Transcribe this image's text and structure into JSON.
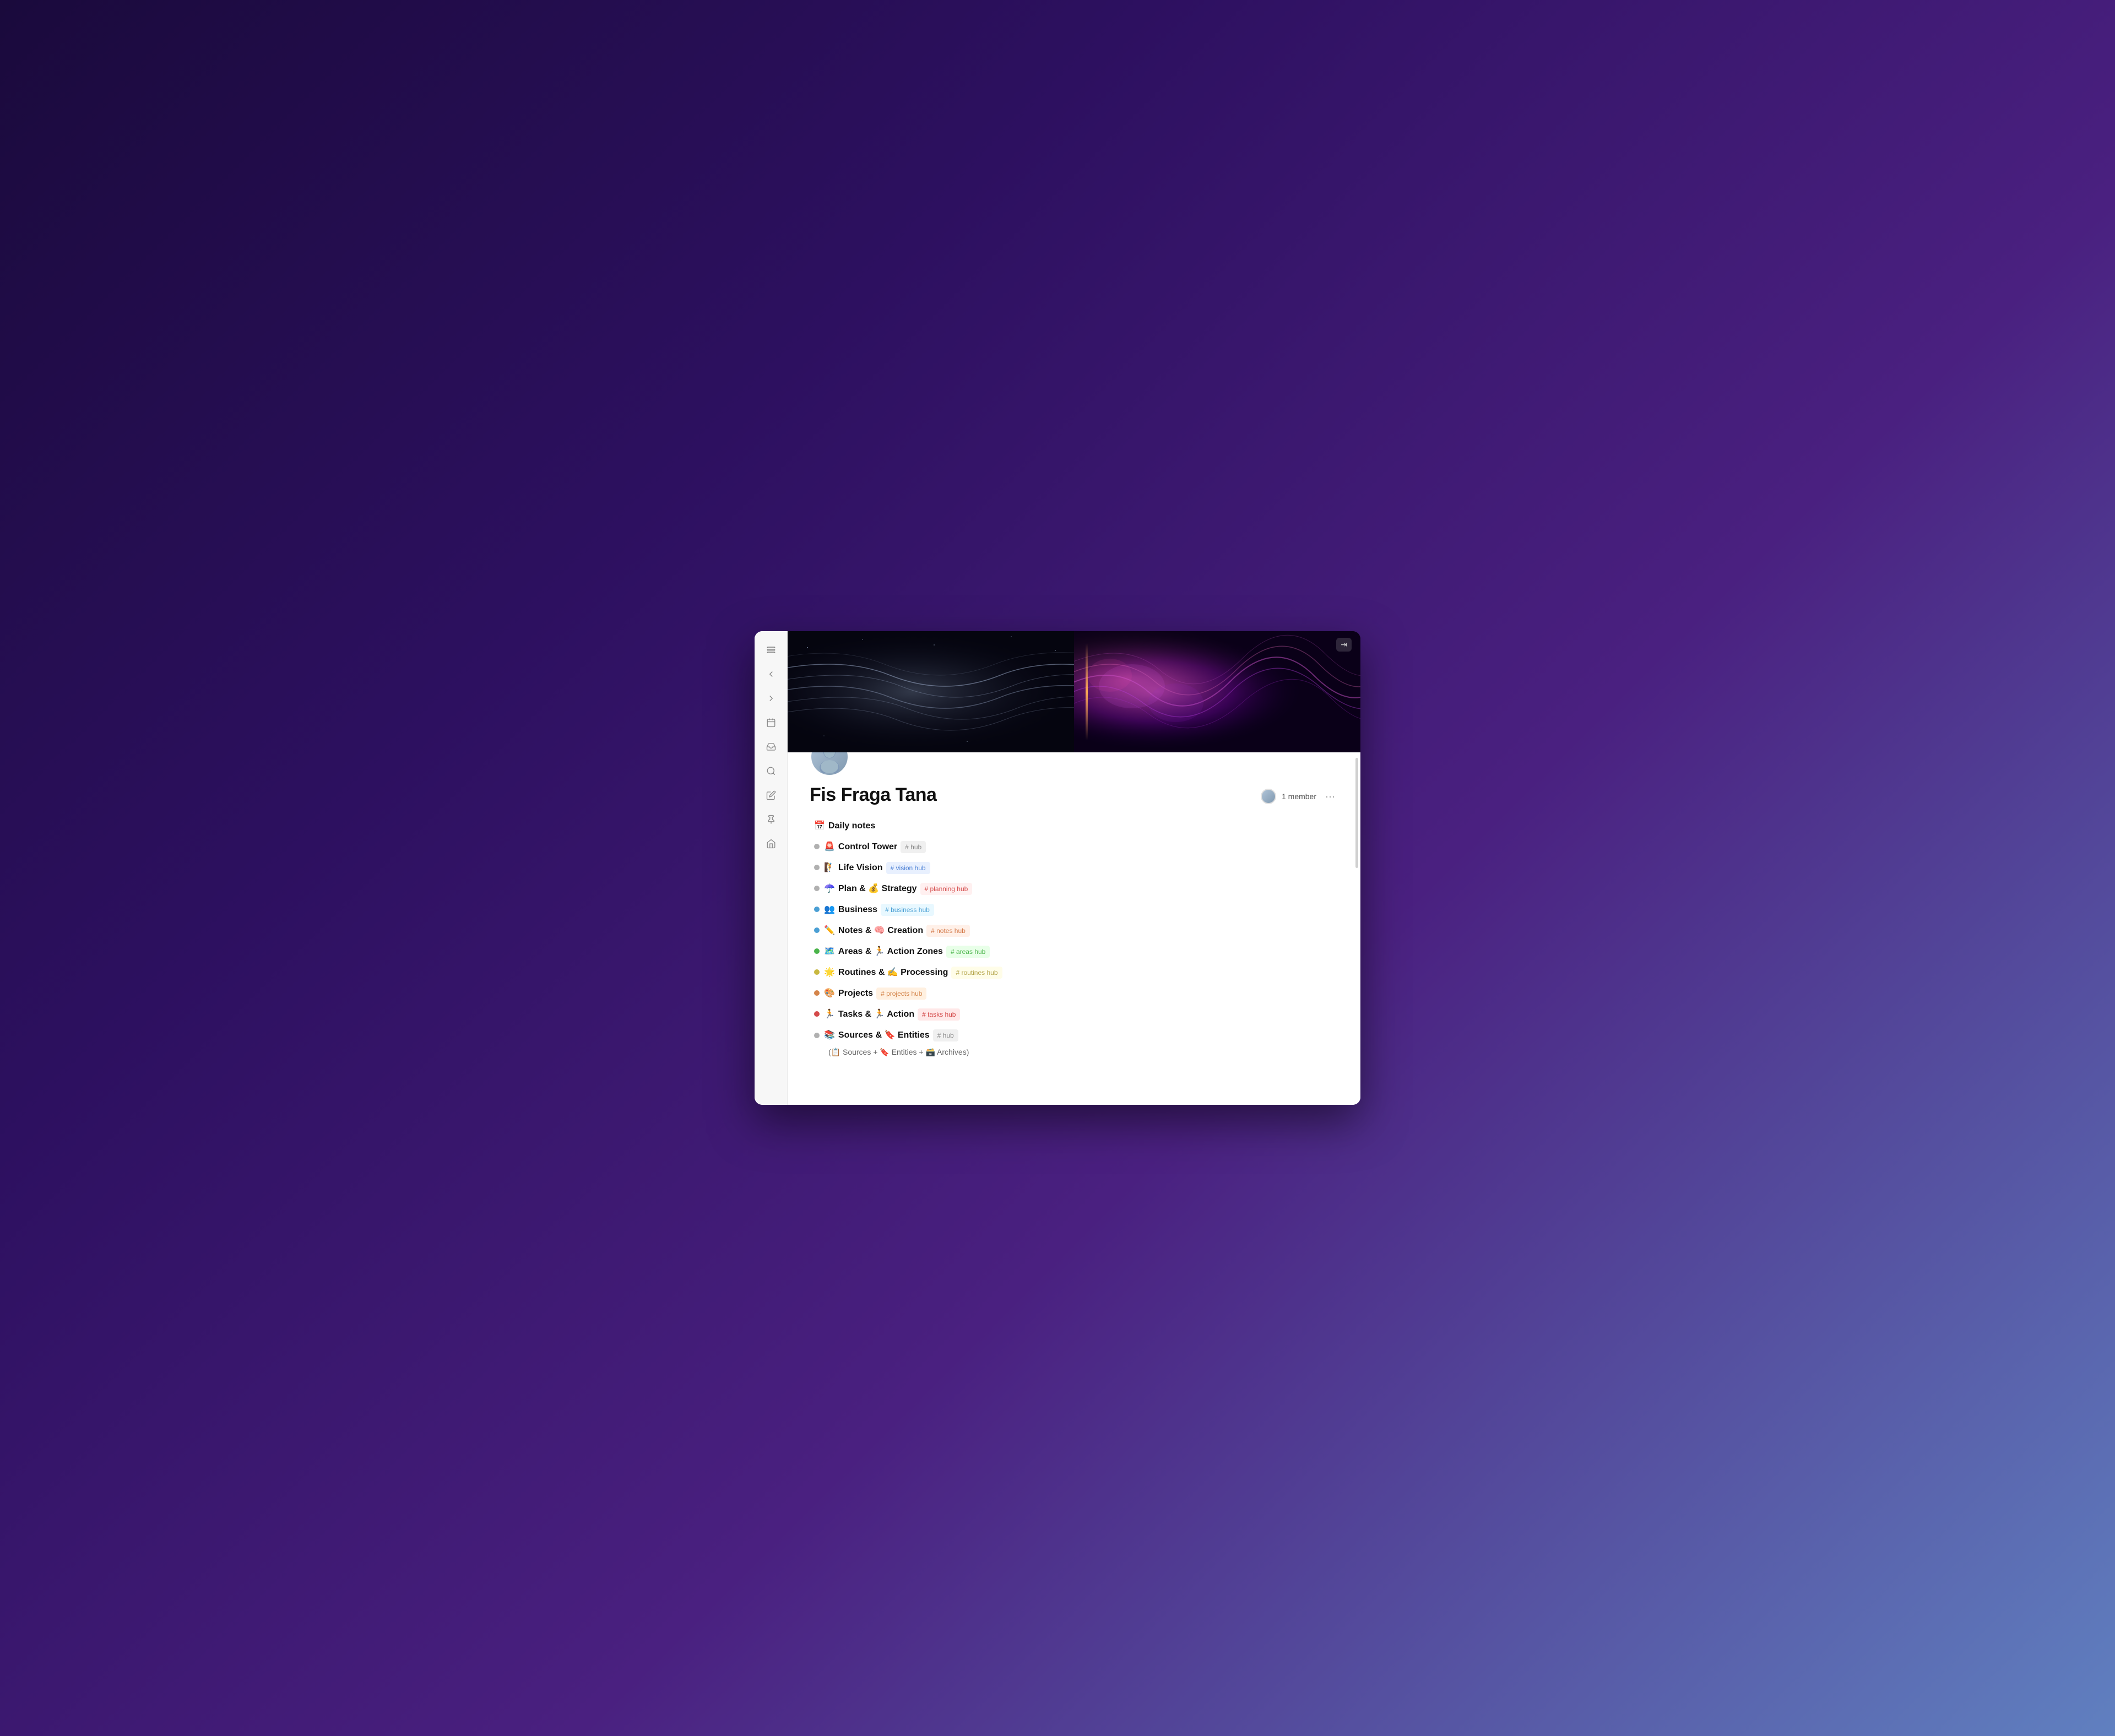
{
  "sidebar": {
    "icons": [
      {
        "name": "sidebar-toggle-icon",
        "symbol": "☰"
      },
      {
        "name": "back-icon",
        "symbol": "←"
      },
      {
        "name": "forward-icon",
        "symbol": "→"
      },
      {
        "name": "calendar-icon",
        "symbol": "📅"
      },
      {
        "name": "inbox-icon",
        "symbol": "📥"
      },
      {
        "name": "search-icon",
        "symbol": "🔍"
      },
      {
        "name": "edit-icon",
        "symbol": "✏️"
      },
      {
        "name": "pin-icon",
        "symbol": "📌"
      },
      {
        "name": "home-icon",
        "symbol": "🏠"
      }
    ]
  },
  "workspace": {
    "title": "Fis Fraga Tana",
    "member_count": "1 member",
    "more_label": "···"
  },
  "items": [
    {
      "dot_color": null,
      "emoji": "📅",
      "text": "Daily notes",
      "tag_text": null,
      "tag_class": null
    },
    {
      "dot_color": "#c0c0c0",
      "emoji": "🚨",
      "text": "Control Tower",
      "tag_text": "# hub",
      "tag_class": "tag-hub"
    },
    {
      "dot_color": "#c0c0c0",
      "emoji": "🧗",
      "text": "Life Vision",
      "tag_text": "# vision hub",
      "tag_class": "tag-vision"
    },
    {
      "dot_color": "#c0c0c0",
      "emoji": "☂️",
      "text": "Plan & 💰 Strategy",
      "tag_text": "# planning hub",
      "tag_class": "tag-planning"
    },
    {
      "dot_color": "#4a9fd4",
      "emoji": "👥",
      "text": "Business",
      "tag_text": "# business hub",
      "tag_class": "tag-business"
    },
    {
      "dot_color": "#4a9fd4",
      "emoji": "✏️",
      "text": "Notes & 🧠 Creation",
      "tag_text": "# notes hub",
      "tag_class": "tag-notes"
    },
    {
      "dot_color": "#4ab44a",
      "emoji": "🗺️",
      "text": "Areas & 🏃 Action Zones",
      "tag_text": "# areas hub",
      "tag_class": "tag-areas"
    },
    {
      "dot_color": "#d4c44a",
      "emoji": "🌟",
      "text": "Routines & ✍️ Processing",
      "tag_text": "# routines hub",
      "tag_class": "tag-routines"
    },
    {
      "dot_color": "#d4844a",
      "emoji": "🎨",
      "text": "Projects",
      "tag_text": "# projects hub",
      "tag_class": "tag-projects"
    },
    {
      "dot_color": "#d44a4a",
      "emoji": "🏃",
      "text": "Tasks & 🏃 Action",
      "tag_text": "# tasks hub",
      "tag_class": "tag-tasks"
    },
    {
      "dot_color": "#c0c0c0",
      "emoji": "📚",
      "text": "Sources & 🔖 Entities",
      "tag_text": "# hub",
      "tag_class": "tag-hub",
      "sub_text": "(📋 Sources + 🔖 Entities + 🗃️ Archives)"
    }
  ],
  "banner": {
    "alt": "Abstract wave banner"
  }
}
